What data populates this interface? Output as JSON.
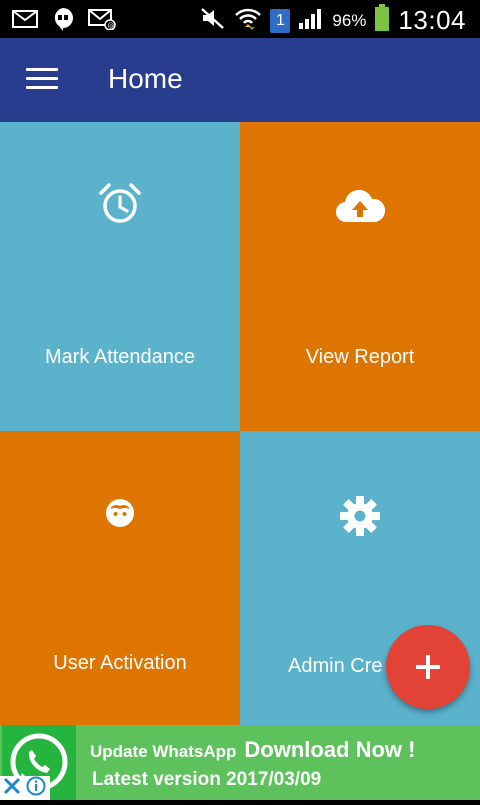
{
  "status_bar": {
    "battery_percent": "96%",
    "time": "13:04",
    "sim_badge": "1",
    "icons": [
      "mail-icon",
      "hangouts-icon",
      "email-icon",
      "mute-icon",
      "wifi-icon",
      "sim-icon",
      "signal-icon",
      "battery-icon"
    ]
  },
  "toolbar": {
    "title": "Home",
    "menu_icon": "menu-icon"
  },
  "tiles": [
    {
      "label": "Mark Attendance",
      "icon": "alarm-clock-icon",
      "color": "#5bb2cb"
    },
    {
      "label": "View Report",
      "icon": "cloud-upload-icon",
      "color": "#dd7500"
    },
    {
      "label": "User Activation",
      "icon": "face-icon",
      "color": "#dd7500"
    },
    {
      "label": "Admin Cre",
      "icon": "gear-icon",
      "color": "#5bb2cb"
    }
  ],
  "fab": {
    "icon": "plus-icon",
    "color": "#e34236"
  },
  "ad": {
    "line1_small": "Update WhatsApp",
    "line1_big": "Download Now !",
    "line2": "Latest version 2017/03/09",
    "icons": [
      "whatsapp-logo-icon",
      "ad-close-icon",
      "ad-info-icon"
    ]
  },
  "colors": {
    "primary": "#283d8e",
    "tile_blue": "#5bb2cb",
    "tile_orange": "#dd7500",
    "ad_green": "#5ec25c"
  }
}
